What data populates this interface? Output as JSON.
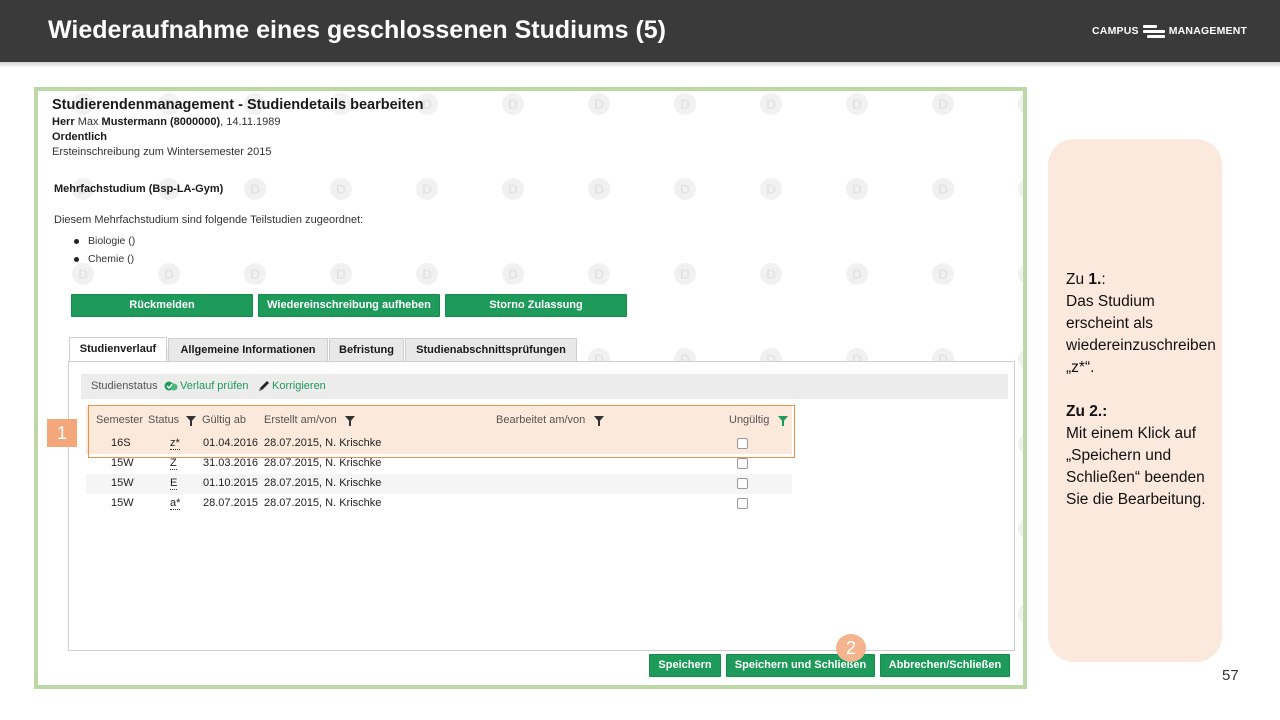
{
  "slide": {
    "title": "Wiederaufnahme eines geschlossenen Studiums (5)",
    "logo_left": "CAMPUS",
    "logo_right": "MANAGEMENT",
    "page_number": "57"
  },
  "app": {
    "title": "Studierendenmanagement - Studiendetails bearbeiten",
    "person_salutation": "Herr",
    "person_first": "Max",
    "person_last": "Mustermann (8000000)",
    "person_birth": ", 14.11.1989",
    "status": "Ordentlich",
    "enrollment": "Ersteinschreibung zum Wintersemester 2015",
    "study_title": "Mehrfachstudium (Bsp-LA-Gym)",
    "study_desc": "Diesem Mehrfachstudium sind folgende Teilstudien zugeordnet:",
    "substudies": [
      "Biologie ()",
      "Chemie ()"
    ],
    "buttons": {
      "rueckmelden": "Rückmelden",
      "wiedereinschreibung": "Wiedereinschreibung aufheben",
      "storno": "Storno Zulassung"
    },
    "tabs": [
      "Studienverlauf",
      "Allgemeine Informationen",
      "Befristung",
      "Studienabschnittsprüfungen"
    ],
    "status_bar": {
      "label": "Studienstatus",
      "check": "Verlauf prüfen",
      "correct": "Korrigieren"
    },
    "table": {
      "headers": {
        "semester": "Semester",
        "status": "Status",
        "valid_from": "Gültig ab",
        "created": "Erstellt am/von",
        "edited": "Bearbeitet am/von",
        "invalid": "Ungültig"
      },
      "rows": [
        {
          "semester": "16S",
          "status": "z*",
          "valid_from": "01.04.2016",
          "created": "28.07.2015, N. Krischke"
        },
        {
          "semester": "15W",
          "status": "Z",
          "valid_from": "31.03.2016",
          "created": "28.07.2015, N. Krischke"
        },
        {
          "semester": "15W",
          "status": "E",
          "valid_from": "01.10.2015",
          "created": "28.07.2015, N. Krischke"
        },
        {
          "semester": "15W",
          "status": "a*",
          "valid_from": "28.07.2015",
          "created": "28.07.2015, N. Krischke"
        }
      ]
    },
    "footer_buttons": {
      "save": "Speichern",
      "save_close": "Speichern und Schließen",
      "cancel": "Abbrechen/Schließen"
    },
    "watermark_letter": "D"
  },
  "markers": {
    "one": "1",
    "two": "2"
  },
  "callout": {
    "line1_prefix": "Zu ",
    "line1_bold": "1.",
    "line1_suffix": ":",
    "text1": "Das Studium erscheint als wiedereinzuschreiben „z*“.",
    "line2_bold": "Zu 2.:",
    "text2": "Mit einem Klick auf „Speichern und Schließen“ beenden Sie die Bearbeitung."
  },
  "colors": {
    "header_bg": "#3a3a3a",
    "frame_border": "#bcd8a7",
    "button_green": "#1e9a5a",
    "highlight_orange": "#e8924a",
    "callout_bg": "#fce9dd"
  }
}
